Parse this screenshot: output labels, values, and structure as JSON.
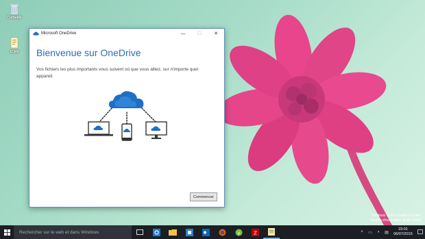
{
  "desktop": {
    "icons": [
      {
        "label": "Corbeille"
      },
      {
        "label": "ICAN"
      }
    ],
    "watermark": [
      "Windows 10 Pro Insider Preview",
      "Version d'évaluation. Build 10158"
    ]
  },
  "window": {
    "title": "Microsoft OneDrive",
    "heading": "Bienvenue sur OneDrive",
    "description": "Vos fichiers les plus importants vous suivent où que vous alliez, sur n'importe quel appareil.",
    "start_button": "Commencer",
    "controls": {
      "minimize": "—",
      "maximize": "☐",
      "close": "✕"
    }
  },
  "taskbar": {
    "search_placeholder": "Rechercher sur le web et dans Windows",
    "apps": [
      "task-view",
      "settings",
      "file-explorer",
      "store",
      "outlook",
      "firefox",
      "utorrent",
      "filezilla",
      "notepad"
    ],
    "time": "23:01",
    "date": "06/07/2015"
  },
  "colors": {
    "accent": "#2b6bb3",
    "taskbar": "#1b1f24",
    "cloud": "#1e6fc6"
  }
}
